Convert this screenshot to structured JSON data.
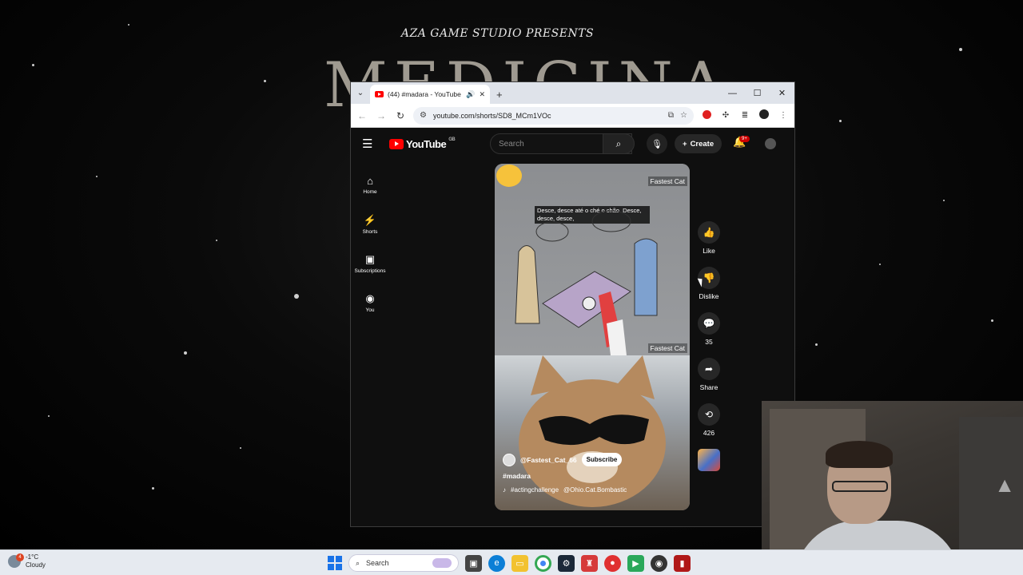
{
  "background": {
    "presents_text": "AZA GAME STUDIO PRESENTS",
    "logo_text": "MEDICINA"
  },
  "browser": {
    "tab_title": "(44) #madara - YouTube",
    "new_tab_label": "+",
    "url": "youtube.com/shorts/SD8_MCm1VOc",
    "window_controls": {
      "minimize": "—",
      "maximize": "☐",
      "close": "✕"
    }
  },
  "youtube": {
    "logo_text": "YouTube",
    "region": "GB",
    "search_placeholder": "Search",
    "create_label": "Create",
    "notification_badge": "9+",
    "sidebar": [
      {
        "label": "Home",
        "icon": "home-icon"
      },
      {
        "label": "Shorts",
        "icon": "shorts-icon"
      },
      {
        "label": "Subscriptions",
        "icon": "subscriptions-icon"
      },
      {
        "label": "You",
        "icon": "you-icon"
      }
    ],
    "short": {
      "channel_tag_top": "Fastest Cat",
      "channel_tag_mid": "Fastest Cat",
      "caption": "Desce, desce até o ché o chão. Desce, desce, desce,",
      "handle": "@Fastest_Cat_66",
      "subscribe_label": "Subscribe",
      "title": "#madara",
      "music_tag": "#actingchallenge",
      "music_credit": "@Ohio.Cat.Bombastic"
    },
    "actions": {
      "like": "Like",
      "dislike": "Dislike",
      "comments": "35",
      "share": "Share",
      "remix": "426"
    }
  },
  "taskbar": {
    "temperature": "-1°C",
    "condition": "Cloudy",
    "weather_badge": "4",
    "search_label": "Search"
  },
  "colors": {
    "yt_red": "#ff0000",
    "yt_bg": "#0f0f0f",
    "windows_blue": "#1a73e8"
  }
}
